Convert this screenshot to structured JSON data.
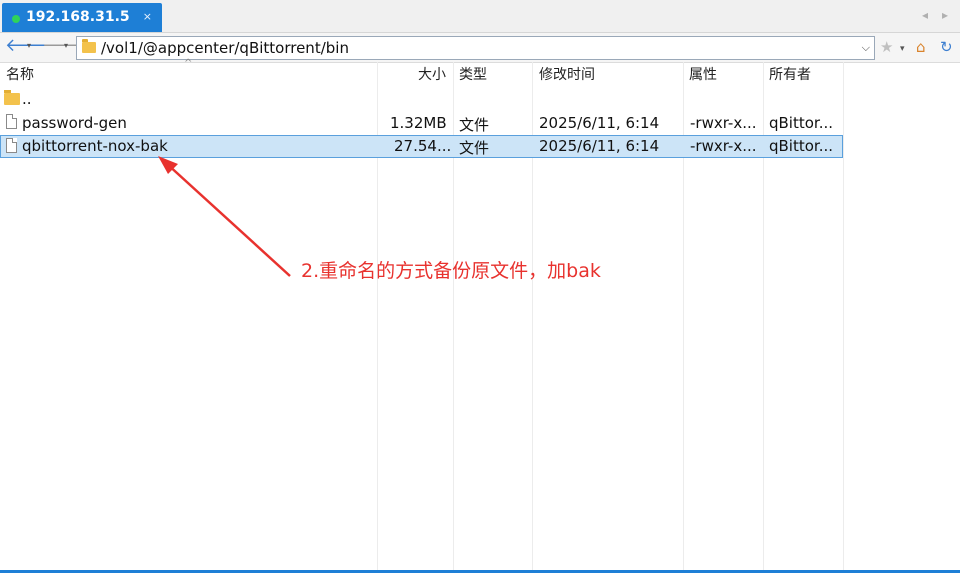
{
  "tab": {
    "title": "192.168.31.5",
    "close": "×",
    "status_color": "#2fd35a"
  },
  "tab_nav": {
    "left": "◂",
    "right": "▸"
  },
  "nav": {
    "back": "🡐",
    "forward": "🡒",
    "caret": "▾"
  },
  "address": {
    "path": "/vol1/@appcenter/qBittorrent/bin",
    "dropdown": "⌵"
  },
  "toolbar": {
    "star": "★",
    "star_caret": "▾",
    "home": "⌂",
    "refresh": "↻"
  },
  "columns": {
    "name": "名称",
    "size": "大小",
    "type": "类型",
    "modified": "修改时间",
    "attr": "属性",
    "owner": "所有者"
  },
  "sort_indicator": "^",
  "files": [
    {
      "name": "..",
      "size": "",
      "type": "",
      "modified": "",
      "attr": "",
      "owner": "",
      "kind": "folder",
      "selected": false
    },
    {
      "name": "password-gen",
      "size": "1.32MB",
      "type": "文件",
      "modified": "2025/6/11, 6:14",
      "attr": "-rwxr-x...",
      "owner": "qBittor...",
      "kind": "file",
      "selected": false
    },
    {
      "name": "qbittorrent-nox-bak",
      "size": "27.54...",
      "type": "文件",
      "modified": "2025/6/11, 6:14",
      "attr": "-rwxr-x...",
      "owner": "qBittor...",
      "kind": "file",
      "selected": true
    }
  ],
  "annotation": {
    "text": "2.重命名的方式备份原文件，加bak",
    "color": "#e8322e"
  },
  "colors": {
    "accent": "#1e7fd6",
    "selection": "#cce4f7"
  }
}
